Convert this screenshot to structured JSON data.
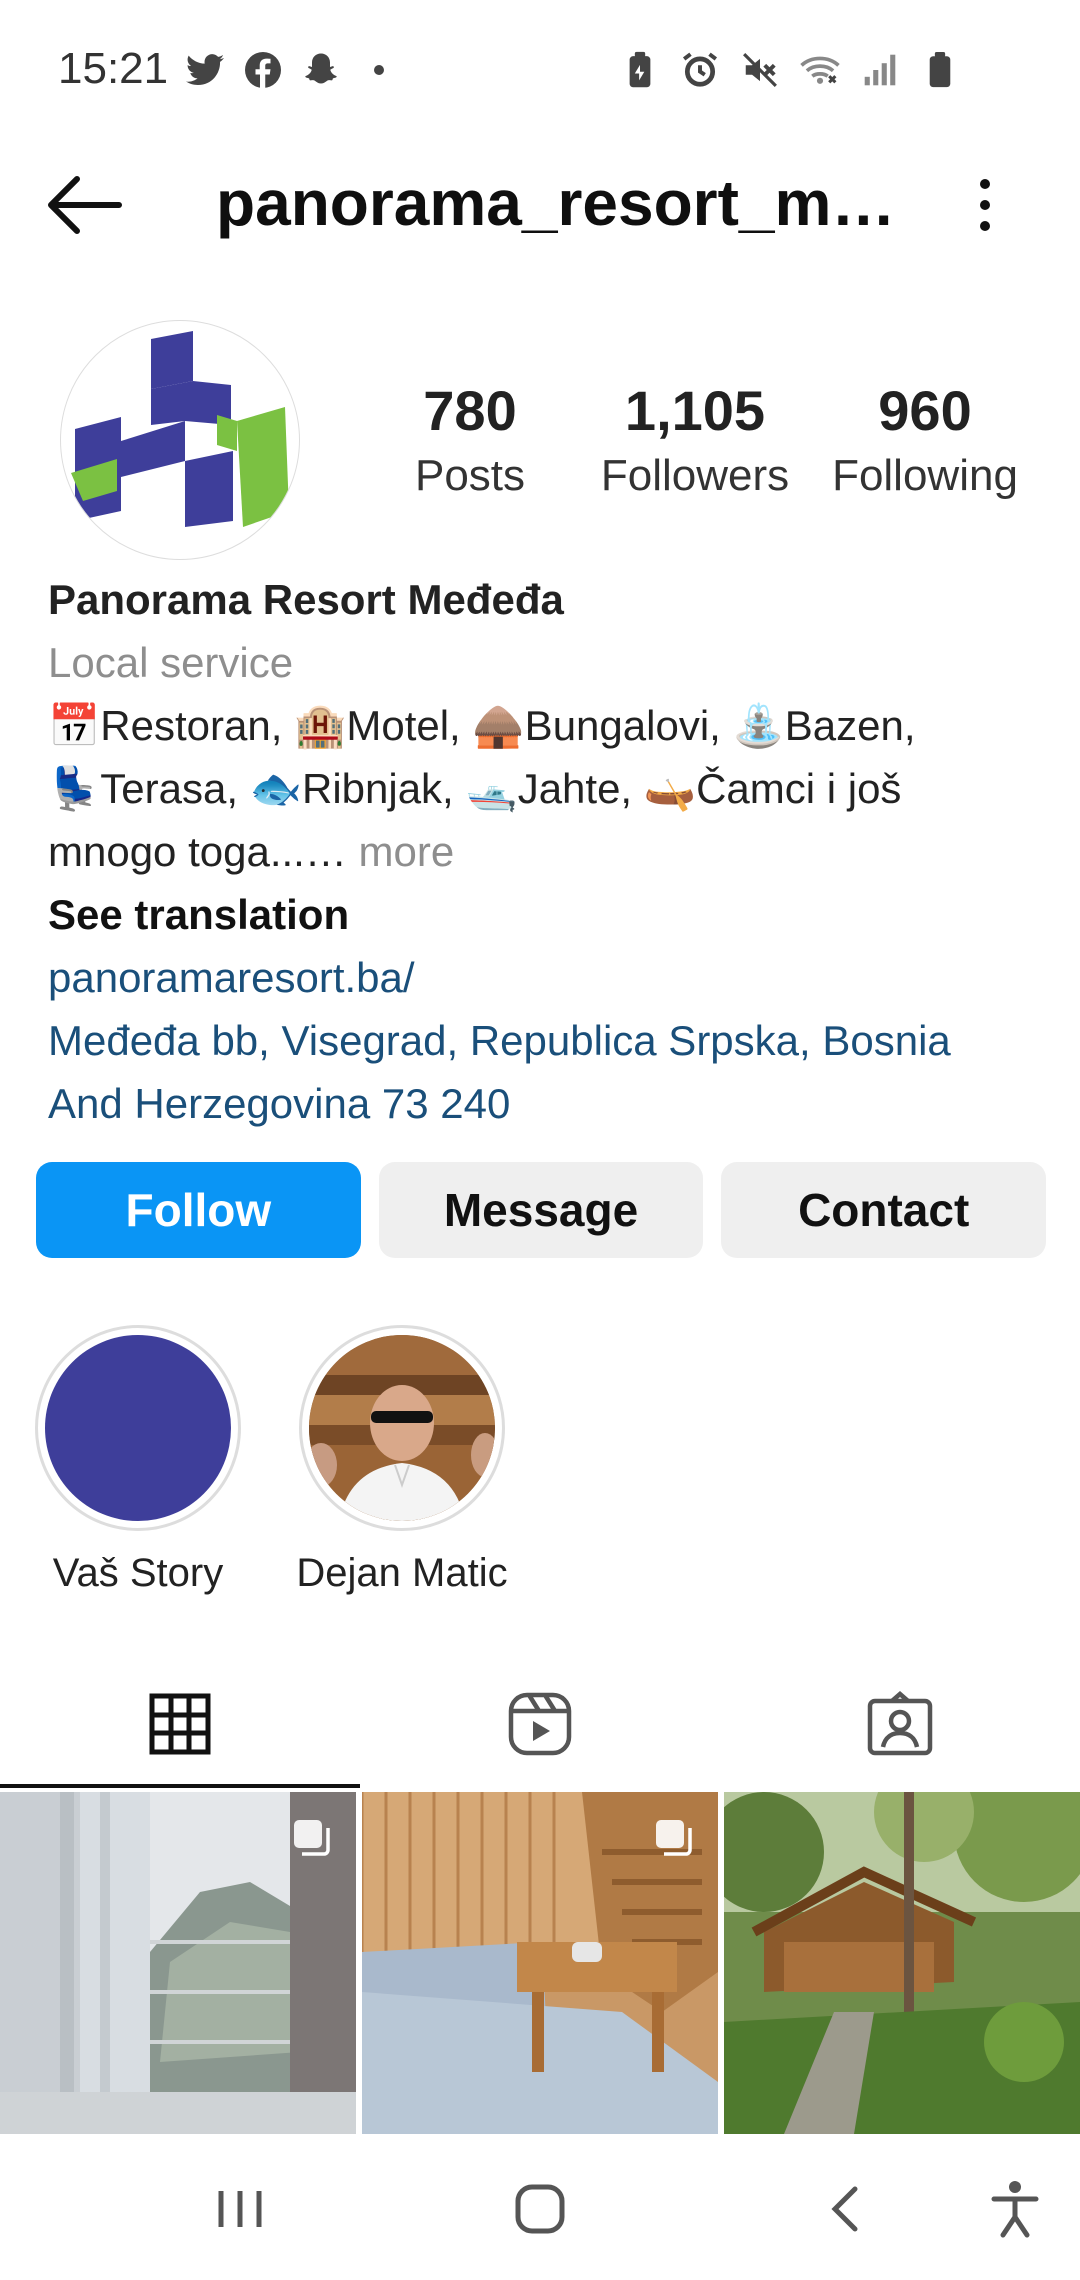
{
  "status_bar": {
    "time": "15:21",
    "left_icons": [
      "twitter-icon",
      "facebook-icon",
      "snapchat-icon",
      "dot-icon"
    ],
    "right_icons": [
      "battery-saver-icon",
      "alarm-icon",
      "mute-icon",
      "wifi-icon",
      "signal-icon",
      "battery-icon"
    ]
  },
  "header": {
    "username": "panorama_resort_me…"
  },
  "profile": {
    "stats": [
      {
        "value": "780",
        "label": "Posts"
      },
      {
        "value": "1,105",
        "label": "Followers"
      },
      {
        "value": "960",
        "label": "Following"
      }
    ],
    "name": "Panorama Resort Međeđa",
    "category": "Local service",
    "bio_line1": "📅Restoran, 🏨Motel, 🛖Bungalovi, ⛲Bazen,",
    "bio_line2": "💺Terasa, 🐟Ribnjak, 🛥️Jahte, 🛶Čamci i još",
    "bio_line3": "mnogo toga...…",
    "more": " more",
    "see_translation": "See translation",
    "website": "panoramaresort.ba/",
    "address_line1": "Međeđa bb, Visegrad, Republica Srpska, Bosnia",
    "address_line2": "And Herzegovina 73 240"
  },
  "buttons": {
    "follow": "Follow",
    "message": "Message",
    "contact": "Contact"
  },
  "highlights": [
    {
      "label": "Vaš Story"
    },
    {
      "label": "Dejan Matic"
    }
  ],
  "tabs": [
    "grid-icon",
    "reels-icon",
    "tagged-icon"
  ],
  "colors": {
    "follow_blue": "#0a95f5",
    "link_blue": "#1a4f7a",
    "logo_blue": "#3e3e9a",
    "logo_green": "#7bc142"
  }
}
